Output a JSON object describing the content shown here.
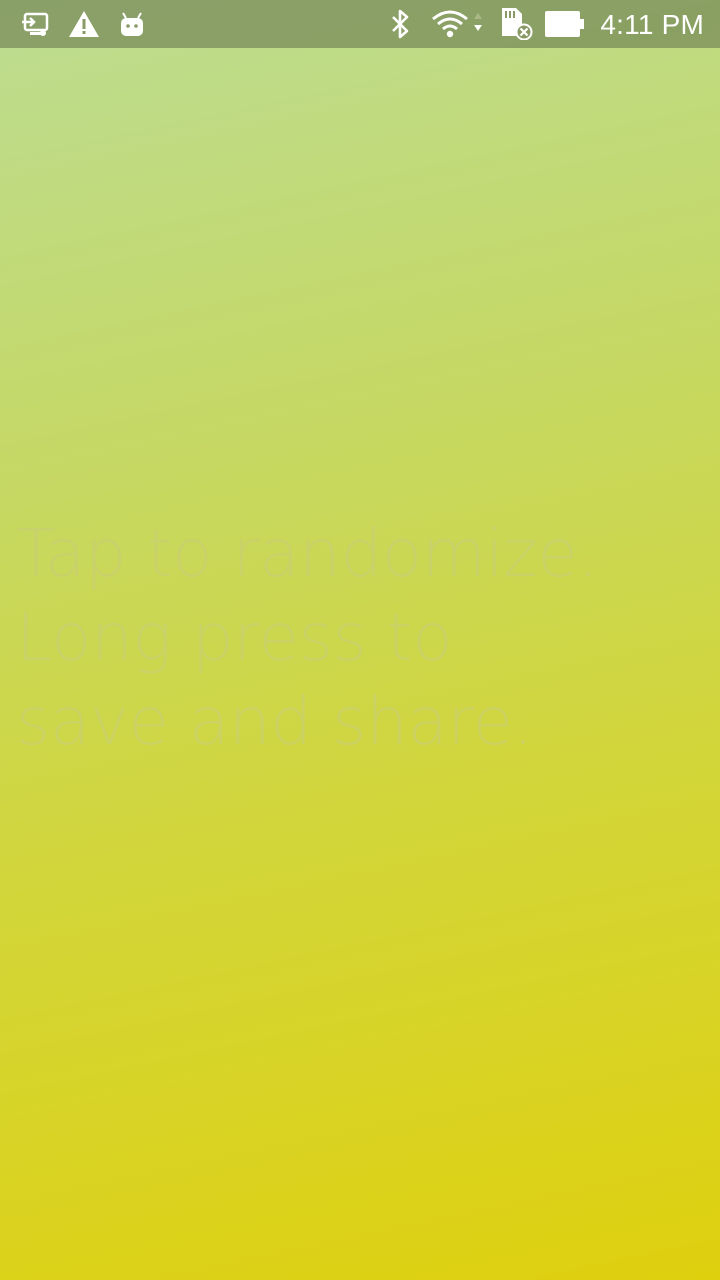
{
  "status_bar": {
    "icons_left": [
      "screen-cast-icon",
      "warning-icon",
      "android-debug-icon"
    ],
    "icons_right": [
      "bluetooth-icon",
      "wifi-icon",
      "sd-card-error-icon",
      "battery-icon"
    ],
    "time": "4:11 PM"
  },
  "main": {
    "hint_lines": [
      "Tap to randomize.",
      "Long press to",
      "save and share."
    ]
  },
  "colors": {
    "gradient_top": "#bcdc92",
    "gradient_bottom": "#dfd00e",
    "status_bar_tint": "#68784e",
    "hint_text": "#c8cd78"
  }
}
